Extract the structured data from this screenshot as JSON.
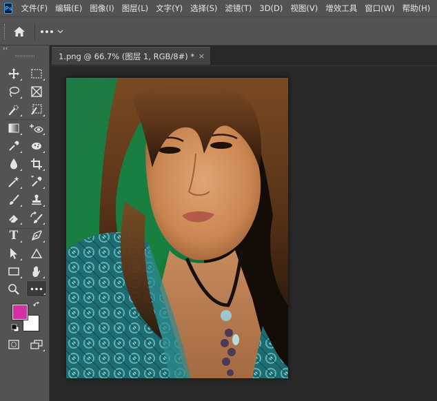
{
  "app": {
    "logo_text": "Ps",
    "accent": "#31a8ff"
  },
  "menu": {
    "items": [
      "文件(F)",
      "编辑(E)",
      "图像(I)",
      "图层(L)",
      "文字(Y)",
      "选择(S)",
      "滤镜(T)",
      "3D(D)",
      "视图(V)",
      "增效工具",
      "窗口(W)",
      "帮助(H)"
    ]
  },
  "options_bar": {
    "home_icon": "home-icon",
    "more_icon": "more-options-icon",
    "dropdown_icon": "chevron-down-icon"
  },
  "toolbar": {
    "collapse_label": "‹‹",
    "foreground_color": "#d62fa6",
    "background_color": "#ffffff",
    "tools": [
      {
        "name": "move-tool",
        "icon": "move-icon"
      },
      {
        "name": "marquee-tool",
        "icon": "rect-marquee-icon"
      },
      {
        "name": "lasso-tool",
        "icon": "lasso-icon"
      },
      {
        "name": "frame-tool",
        "icon": "frame-icon"
      },
      {
        "name": "quick-select-tool",
        "icon": "quick-select-icon"
      },
      {
        "name": "slice-tool",
        "icon": "slice-icon"
      },
      {
        "name": "gradient-tool",
        "icon": "gradient-icon"
      },
      {
        "name": "red-eye-tool",
        "icon": "red-eye-icon"
      },
      {
        "name": "eyedropper-tool",
        "icon": "eyedropper-icon"
      },
      {
        "name": "sponge-tool",
        "icon": "sponge-icon"
      },
      {
        "name": "blur-tool",
        "icon": "drop-icon"
      },
      {
        "name": "crop-tool",
        "icon": "crop-icon"
      },
      {
        "name": "magic-wand-tool",
        "icon": "magic-wand-icon"
      },
      {
        "name": "color-sampler-tool",
        "icon": "color-sampler-icon"
      },
      {
        "name": "brush-tool",
        "icon": "brush-icon"
      },
      {
        "name": "stamp-tool",
        "icon": "stamp-icon"
      },
      {
        "name": "eraser-tool",
        "icon": "eraser-icon"
      },
      {
        "name": "history-brush-tool",
        "icon": "history-brush-icon"
      },
      {
        "name": "type-tool",
        "icon": "type-icon",
        "label": "T"
      },
      {
        "name": "pen-tool",
        "icon": "pen-icon"
      },
      {
        "name": "path-select-tool",
        "icon": "arrow-icon"
      },
      {
        "name": "shape-3d-tool",
        "icon": "triangle-icon"
      },
      {
        "name": "rectangle-tool",
        "icon": "rectangle-icon"
      },
      {
        "name": "hand-tool",
        "icon": "hand-icon"
      },
      {
        "name": "zoom-tool",
        "icon": "zoom-icon"
      },
      {
        "name": "edit-toolbar",
        "icon": "more-icon"
      },
      {
        "name": "quick-mask-button",
        "icon": "quick-mask-icon"
      },
      {
        "name": "screen-mode-button",
        "icon": "screen-mode-icon"
      }
    ]
  },
  "document": {
    "tab_title": "1.png @ 66.7% (图层 1, RGB/8#) *",
    "close_label": "×"
  }
}
